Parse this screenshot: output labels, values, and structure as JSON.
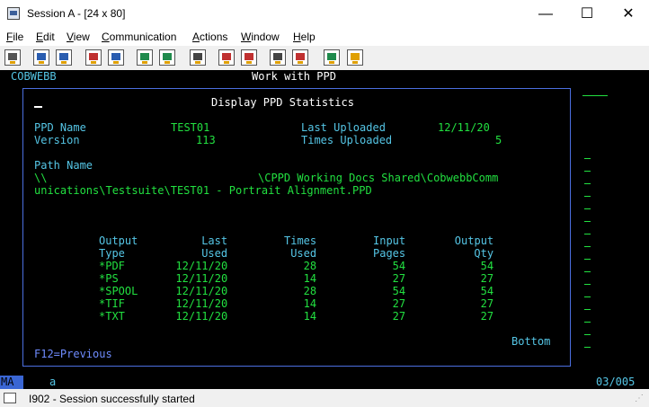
{
  "window": {
    "title": "Session A - [24 x 80]",
    "min_glyph": "—",
    "max_glyph": "☐",
    "close_glyph": "✕"
  },
  "menu": [
    {
      "name": "menu-file",
      "accel": "F",
      "rest": "ile"
    },
    {
      "name": "menu-edit",
      "accel": "E",
      "rest": "dit"
    },
    {
      "name": "menu-view",
      "accel": "V",
      "rest": "iew"
    },
    {
      "name": "menu-communication",
      "accel": "C",
      "rest": "ommunication"
    },
    {
      "name": "menu-actions",
      "accel": "A",
      "rest": "ctions"
    },
    {
      "name": "menu-window",
      "accel": "W",
      "rest": "indow"
    },
    {
      "name": "menu-help",
      "accel": "H",
      "rest": "elp"
    }
  ],
  "toolbar": [
    "print-screen-icon",
    "copy-icon",
    "paste-icon",
    "send-file-icon",
    "receive-file-icon",
    "display-keypad-icon",
    "quick-keypad-icon",
    "macro-record-icon",
    "macro-stop-icon",
    "macro-play-icon",
    "macro-pause-icon",
    "macro-icon",
    "globe-icon",
    "customize-icon"
  ],
  "terminal": {
    "system_name": "COBWEBB",
    "screen_title": "Work with PPD",
    "window_title": "Display PPD Statistics",
    "ppd_name_label": "PPD Name",
    "ppd_name_value": "TEST01",
    "version_label": "Version",
    "version_value": "113",
    "last_uploaded_label": "Last Uploaded",
    "last_uploaded_value": "12/11/20",
    "times_uploaded_label": "Times Uploaded",
    "times_uploaded_value": "5",
    "path_label": "Path Name",
    "path_line1_prefix": "\\\\",
    "path_line1": "\\CPPD Working Docs Shared\\CobwebbComm",
    "path_line2": "unications\\Testsuite\\TEST01 - Portrait Alignment.PPD",
    "columns": [
      {
        "h1": "Output",
        "h2": "Type"
      },
      {
        "h1": "Last",
        "h2": "Used"
      },
      {
        "h1": "Times",
        "h2": "Used"
      },
      {
        "h1": "Input",
        "h2": "Pages"
      },
      {
        "h1": "Output",
        "h2": "Qty"
      }
    ],
    "rows": [
      {
        "type": "*PDF",
        "last_used": "12/11/20",
        "times_used": "28",
        "input_pages": "54",
        "output_qty": "54"
      },
      {
        "type": "*PS",
        "last_used": "12/11/20",
        "times_used": "14",
        "input_pages": "27",
        "output_qty": "27"
      },
      {
        "type": "*SPOOL",
        "last_used": "12/11/20",
        "times_used": "28",
        "input_pages": "54",
        "output_qty": "54"
      },
      {
        "type": "*TIF",
        "last_used": "12/11/20",
        "times_used": "14",
        "input_pages": "27",
        "output_qty": "27"
      },
      {
        "type": "*TXT",
        "last_used": "12/11/20",
        "times_used": "14",
        "input_pages": "27",
        "output_qty": "27"
      }
    ],
    "bottom_label": "Bottom",
    "function_keys": "F12=Previous"
  },
  "oia": {
    "mode": "MA",
    "indicator": "a",
    "cursor_position": "03/005"
  },
  "status": {
    "message": "I902 - Session successfully started"
  },
  "colors": {
    "terminal_bg": "#000000",
    "field_green": "#22e040",
    "text_cyan": "#55c6e6",
    "border_blue": "#4b6fe0"
  }
}
